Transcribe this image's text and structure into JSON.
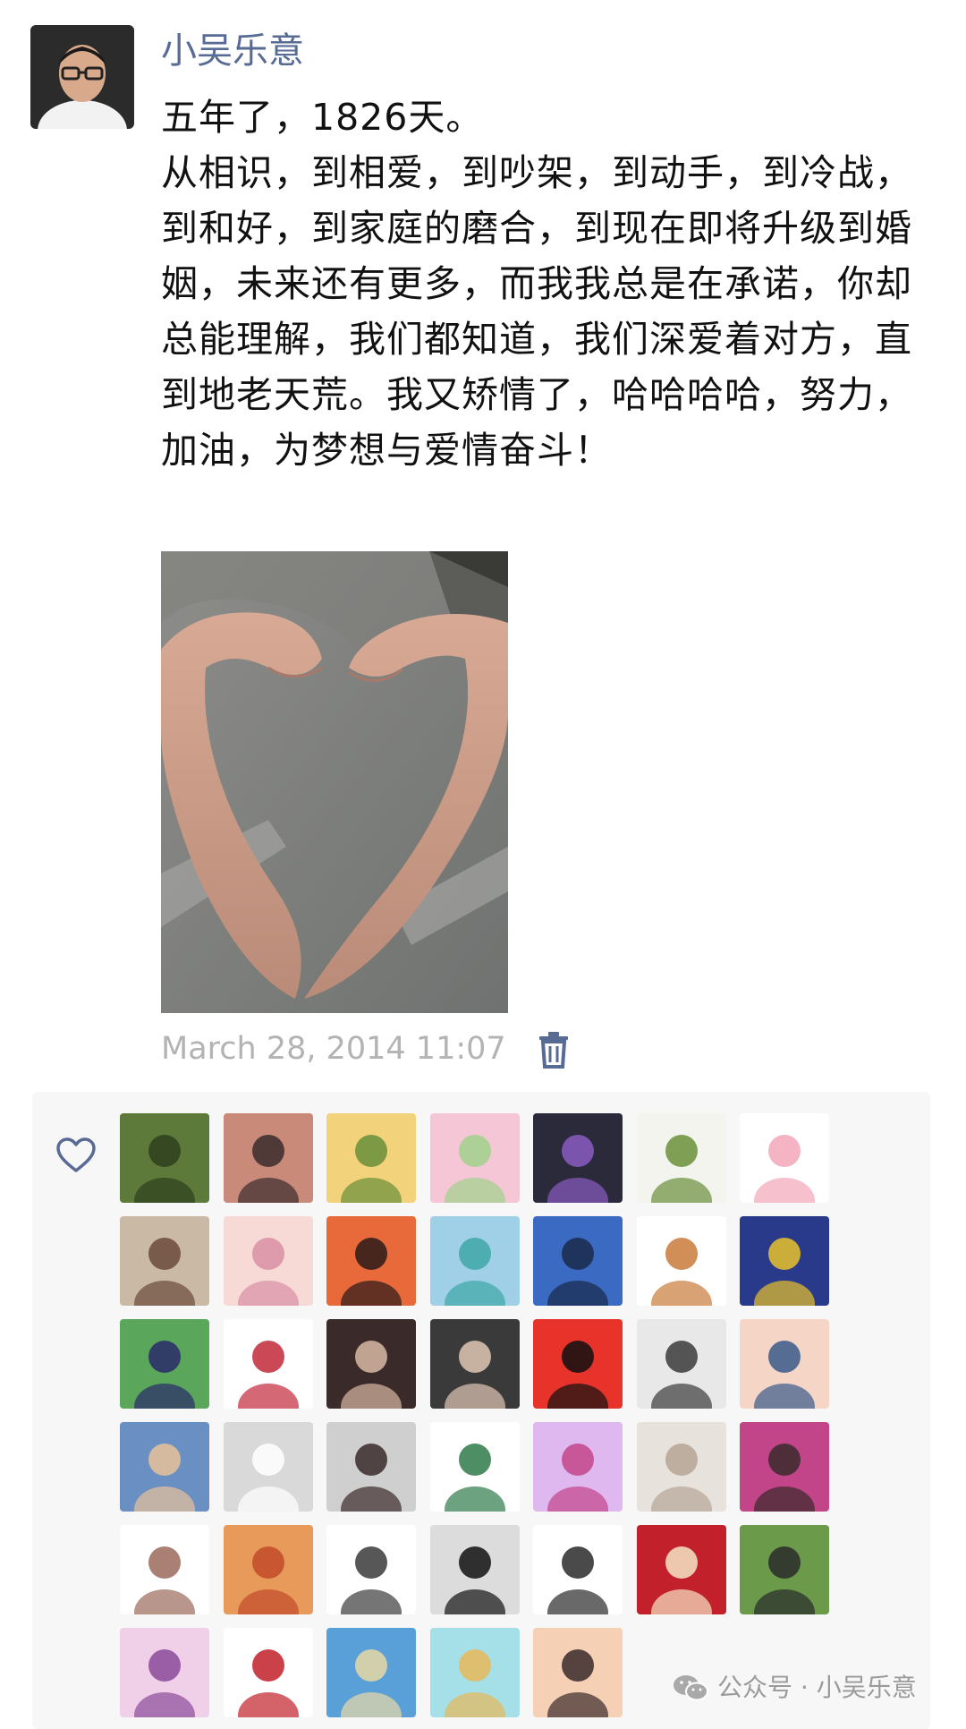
{
  "post": {
    "author": "小吴乐意",
    "lines": [
      "五年了，1826天。",
      "从相识，到相爱，到吵架，到动手，到冷战，到和好，到家庭的磨合，到现在即将升级到婚姻，未来还有更多，而我我总是在承诺，你却总能理解，我们都知道，我们深爱着对方，直到地老天荒。我又矫情了，哈哈哈哈，努力，加油，为梦想与爱情奋斗！"
    ],
    "timestamp": "March 28, 2014 11:07",
    "photo_icon": "heart-hands-photo"
  },
  "likes": {
    "icon": "heart-outline-icon",
    "liker_count": 40
  },
  "watermark": {
    "text": "公众号 · 小吴乐意",
    "icon": "wechat-icon"
  },
  "colors": {
    "username": "#576b95",
    "timestamp": "#b3b3b3",
    "panel_bg": "#f7f7f7"
  }
}
